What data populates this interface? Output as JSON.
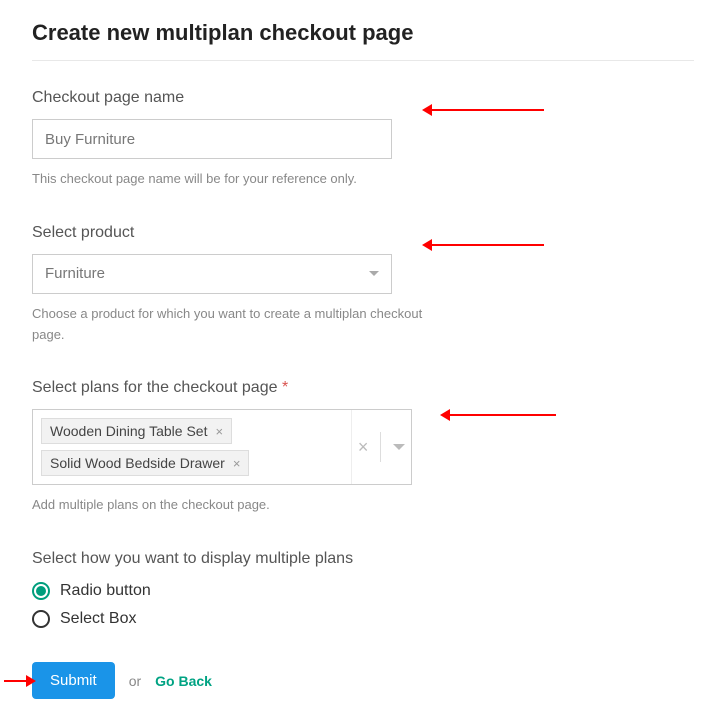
{
  "title": "Create new multiplan checkout page",
  "fields": {
    "name": {
      "label": "Checkout page name",
      "value": "Buy Furniture",
      "hint": "This checkout page name will be for your reference only."
    },
    "product": {
      "label": "Select product",
      "value": "Furniture",
      "hint": "Choose a product for which you want to create a multiplan checkout page."
    },
    "plans": {
      "label": "Select plans for the checkout page",
      "required_marker": "*",
      "tags": [
        "Wooden Dining Table Set",
        "Solid Wood Bedside Drawer"
      ],
      "hint": "Add multiple plans on the checkout page."
    },
    "display": {
      "label": "Select how you want to display multiple plans",
      "options": [
        "Radio button",
        "Select Box"
      ],
      "selected_index": 0
    }
  },
  "actions": {
    "submit": "Submit",
    "or": "or",
    "go_back": "Go Back"
  }
}
